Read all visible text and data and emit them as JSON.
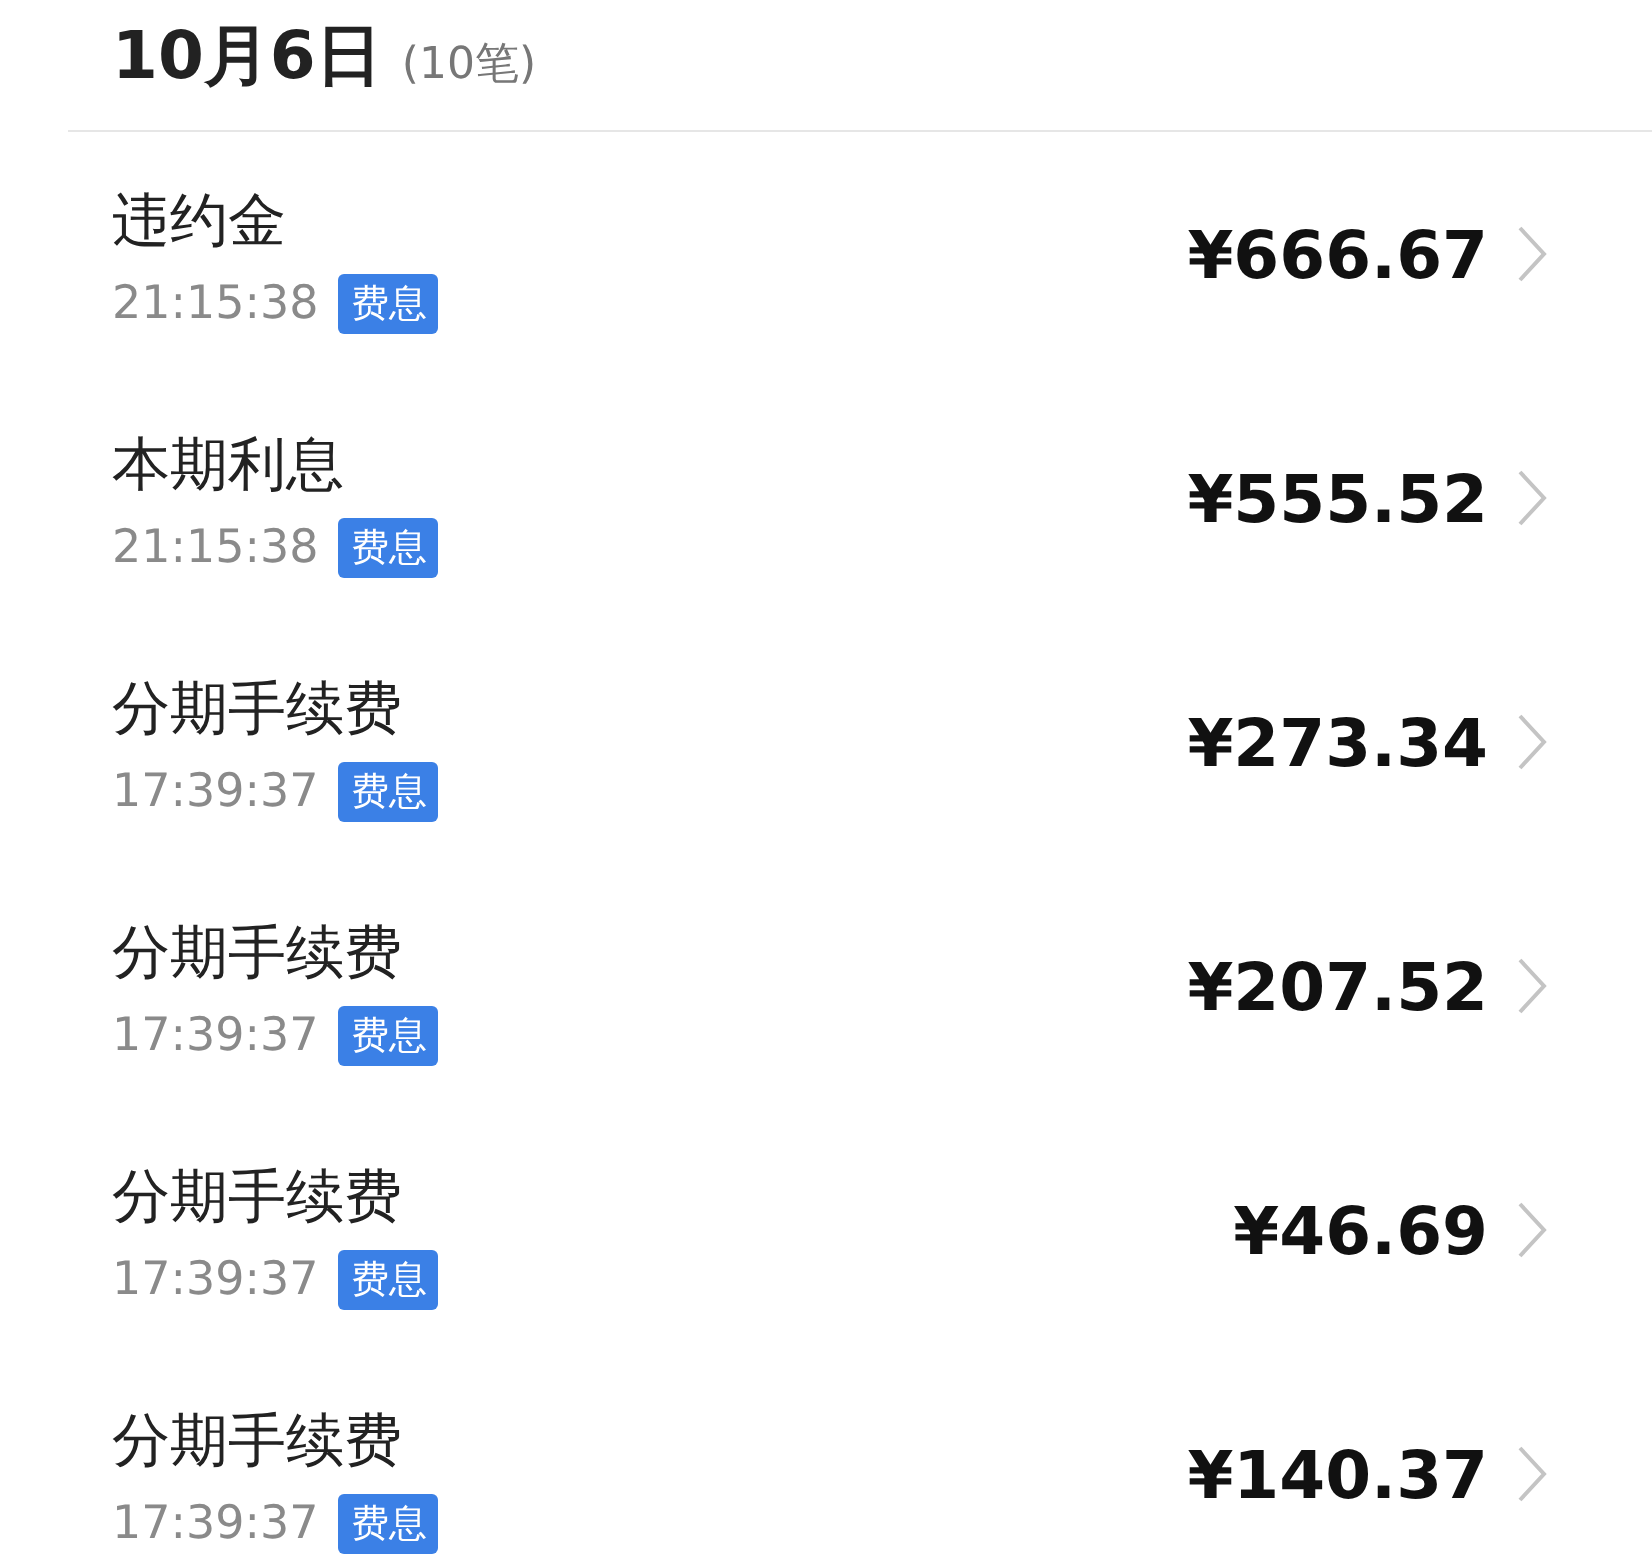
{
  "header": {
    "date": "10月6日",
    "count": "(10笔)"
  },
  "transactions": [
    {
      "title": "违约金",
      "time": "21:15:38",
      "tag": "费息",
      "amount": "¥666.67"
    },
    {
      "title": "本期利息",
      "time": "21:15:38",
      "tag": "费息",
      "amount": "¥555.52"
    },
    {
      "title": "分期手续费",
      "time": "17:39:37",
      "tag": "费息",
      "amount": "¥273.34"
    },
    {
      "title": "分期手续费",
      "time": "17:39:37",
      "tag": "费息",
      "amount": "¥207.52"
    },
    {
      "title": "分期手续费",
      "time": "17:39:37",
      "tag": "费息",
      "amount": "¥46.69"
    },
    {
      "title": "分期手续费",
      "time": "17:39:37",
      "tag": "费息",
      "amount": "¥140.37"
    }
  ]
}
